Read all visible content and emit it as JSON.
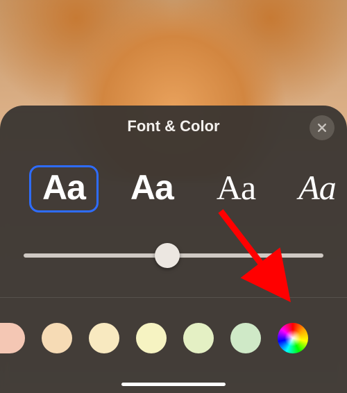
{
  "sheet": {
    "title": "Font & Color",
    "close_icon": "close-icon"
  },
  "fonts": {
    "options": [
      {
        "sample": "Aa",
        "selected": true
      },
      {
        "sample": "Aa",
        "selected": false
      },
      {
        "sample": "Aa",
        "selected": false
      },
      {
        "sample": "Aa",
        "selected": false
      }
    ]
  },
  "weight_slider": {
    "min": 0,
    "max": 100,
    "value": 48
  },
  "colors": {
    "swatches": [
      "#f4c7b4",
      "#f6dbb5",
      "#f8e9c0",
      "#f6f3c2",
      "#e4f0c4",
      "#cfe9c7"
    ],
    "picker": "color-wheel"
  },
  "annotation": {
    "type": "arrow",
    "color": "#ff0000",
    "target": "color-picker-button"
  }
}
